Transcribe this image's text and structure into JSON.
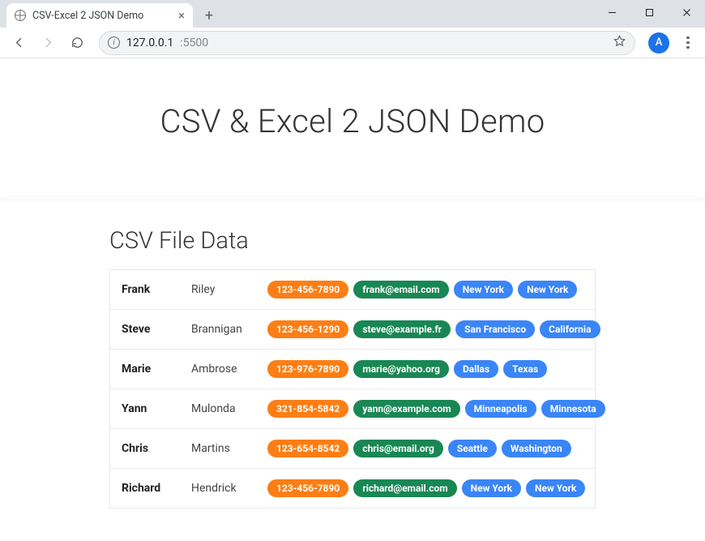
{
  "browser": {
    "tab_title": "CSV-Excel 2 JSON Demo",
    "url_host": "127.0.0.1",
    "url_port": ":5500",
    "avatar_initial": "A"
  },
  "page": {
    "hero_title": "CSV & Excel 2 JSON Demo",
    "section_title": "CSV File Data"
  },
  "rows": [
    {
      "first": "Frank",
      "last": "Riley",
      "phone": "123-456-7890",
      "email": "frank@email.com",
      "city": "New York",
      "state": "New York"
    },
    {
      "first": "Steve",
      "last": "Brannigan",
      "phone": "123-456-1290",
      "email": "steve@example.fr",
      "city": "San Francisco",
      "state": "California"
    },
    {
      "first": "Marie",
      "last": "Ambrose",
      "phone": "123-976-7890",
      "email": "marie@yahoo.org",
      "city": "Dallas",
      "state": "Texas"
    },
    {
      "first": "Yann",
      "last": "Mulonda",
      "phone": "321-854-5842",
      "email": "yann@example.com",
      "city": "Minneapolis",
      "state": "Minnesota"
    },
    {
      "first": "Chris",
      "last": "Martins",
      "phone": "123-654-8542",
      "email": "chris@email.org",
      "city": "Seattle",
      "state": "Washington"
    },
    {
      "first": "Richard",
      "last": "Hendrick",
      "phone": "123-456-7890",
      "email": "richard@email.com",
      "city": "New York",
      "state": "New York"
    }
  ],
  "colors": {
    "phone": "#fd7e14",
    "email": "#198754",
    "location": "#3a85f7",
    "avatar": "#1a73e8"
  }
}
